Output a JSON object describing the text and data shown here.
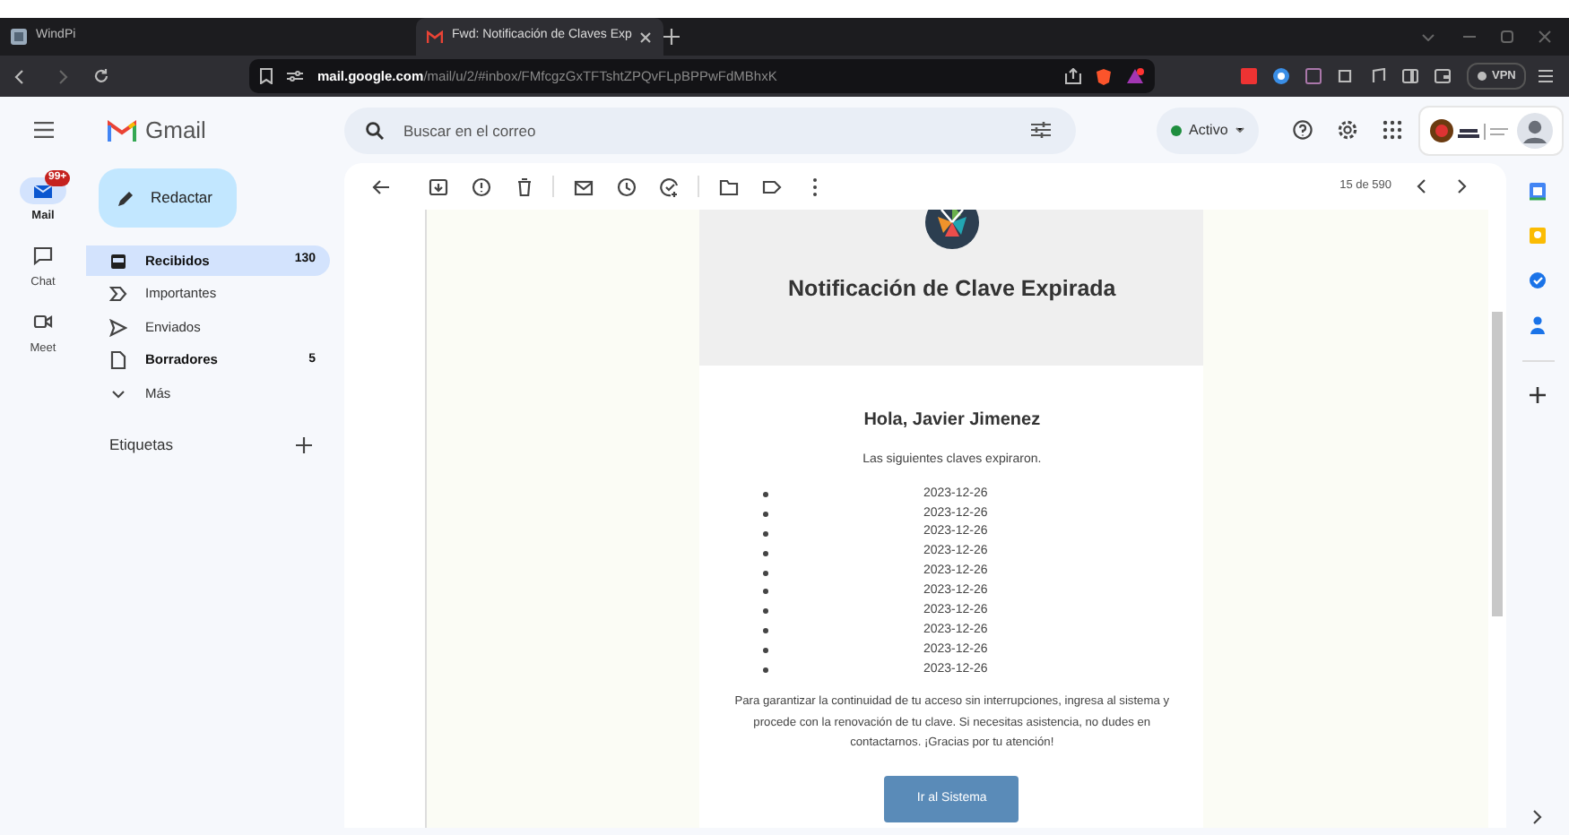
{
  "browser": {
    "tabs": [
      {
        "title": "WindPi",
        "selected": false
      },
      {
        "title": "Fwd: Notificación de Claves Exp",
        "selected": true
      }
    ],
    "address": {
      "host": "mail.google.com",
      "path": "/mail/u/2/#inbox/FMfcgzGxTFTshtZPQvFLpBPPwFdMBhxK"
    },
    "vpn_label": "VPN"
  },
  "gmail": {
    "brand": "Gmail",
    "rail": [
      {
        "label": "Mail",
        "selected": true,
        "badge": "99+"
      },
      {
        "label": "Chat",
        "selected": false
      },
      {
        "label": "Meet",
        "selected": false
      }
    ],
    "search": {
      "placeholder": "Buscar en el correo"
    },
    "status": "Activo",
    "compose": "Redactar",
    "folders": [
      {
        "kind": "inbox",
        "label": "Recibidos",
        "count": "130",
        "selected": true,
        "unread": true
      },
      {
        "kind": "important",
        "label": "Importantes",
        "selected": false,
        "unread": false
      },
      {
        "kind": "sent",
        "label": "Enviados",
        "selected": false,
        "unread": false
      },
      {
        "kind": "drafts",
        "label": "Borradores",
        "count": "5",
        "selected": false,
        "unread": true
      },
      {
        "kind": "more",
        "label": "Más",
        "selected": false,
        "unread": false
      }
    ],
    "labels_heading": "Etiquetas",
    "counter": "15 de 590"
  },
  "email": {
    "title": "Notificación de Clave Expirada",
    "greeting": "Hola, Javier Jimenez",
    "intro": "Las siguientes claves expiraron.",
    "dates": [
      "2023-12-26",
      "2023-12-26",
      "2023-12-26",
      "2023-12-26",
      "2023-12-26",
      "2023-12-26",
      "2023-12-26",
      "2023-12-26",
      "2023-12-26",
      "2023-12-26"
    ],
    "message": "Para garantizar la continuidad de tu acceso sin interrupciones, ingresa al sistema y procede con la renovación de tu clave. Si necesitas asistencia, no dudes en contactarnos. ¡Gracias por tu atención!",
    "button": "Ir al Sistema"
  }
}
